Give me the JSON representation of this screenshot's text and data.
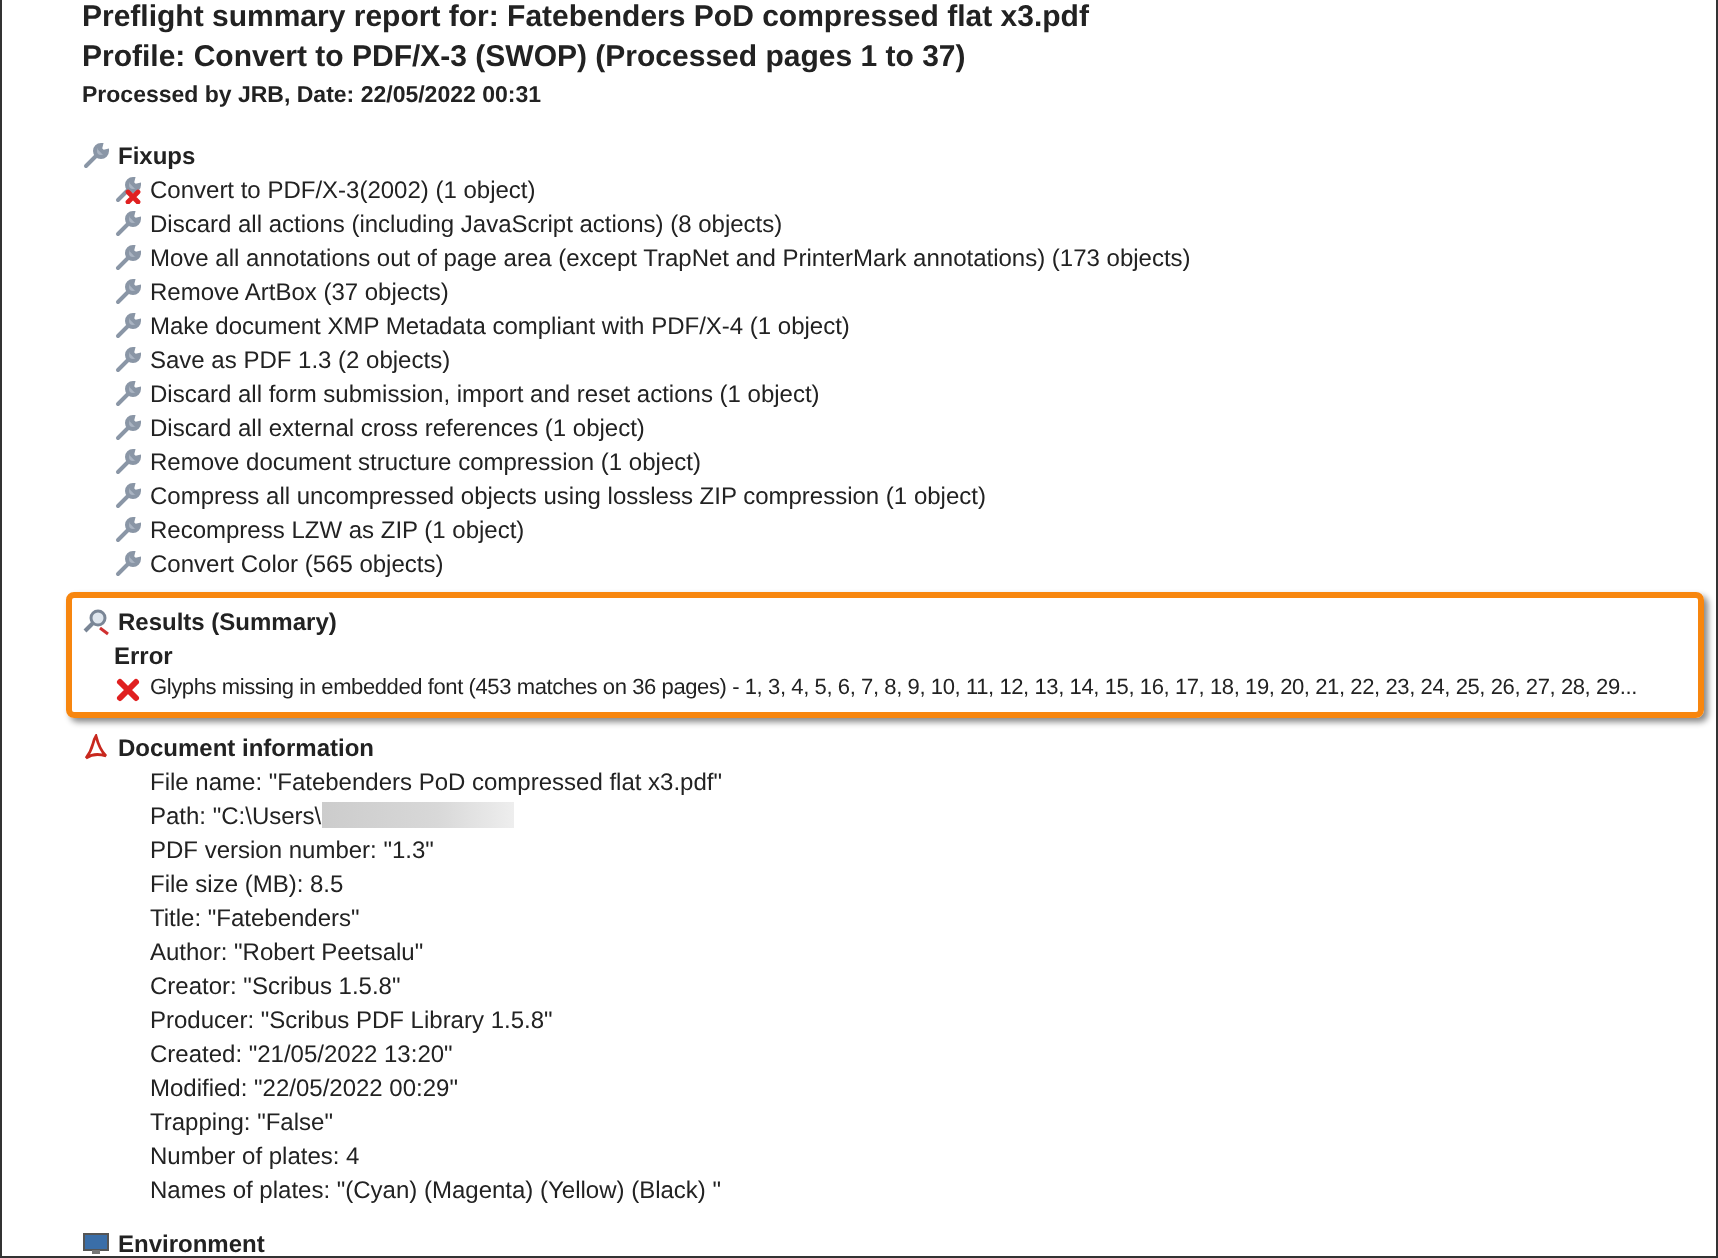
{
  "report": {
    "title": "Preflight summary report for: Fatebenders PoD compressed flat x3.pdf",
    "profile": "Profile: Convert to PDF/X-3 (SWOP) (Processed pages 1 to 37)",
    "processed_by": "Processed by JRB, Date: 22/05/2022 00:31"
  },
  "fixups": {
    "heading": "Fixups",
    "items": [
      {
        "label": "Convert to PDF/X-3(2002) (1 object)",
        "failed": true
      },
      {
        "label": "Discard all actions (including JavaScript actions) (8 objects)",
        "failed": false
      },
      {
        "label": "Move all annotations out of page area (except TrapNet and PrinterMark annotations) (173 objects)",
        "failed": false
      },
      {
        "label": "Remove ArtBox (37 objects)",
        "failed": false
      },
      {
        "label": "Make document XMP Metadata compliant with PDF/X-4 (1 object)",
        "failed": false
      },
      {
        "label": "Save as PDF 1.3 (2 objects)",
        "failed": false
      },
      {
        "label": "Discard all form submission, import and reset actions (1 object)",
        "failed": false
      },
      {
        "label": "Discard all external cross references (1 object)",
        "failed": false
      },
      {
        "label": "Remove document structure compression (1 object)",
        "failed": false
      },
      {
        "label": "Compress all uncompressed objects using lossless ZIP compression (1 object)",
        "failed": false
      },
      {
        "label": "Recompress LZW as ZIP (1 object)",
        "failed": false
      },
      {
        "label": "Convert Color (565 objects)",
        "failed": false
      }
    ]
  },
  "results": {
    "heading": "Results (Summary)",
    "highlighted": true,
    "groups": [
      {
        "severity": "Error",
        "items": [
          {
            "text": "Glyphs missing in embedded font (453 matches on 36 pages) - 1, 3, 4, 5, 6, 7, 8, 9, 10, 11, 12, 13, 14, 15, 16, 17, 18, 19, 20, 21, 22, 23, 24, 25, 26, 27, 28, 29..."
          }
        ]
      }
    ]
  },
  "document_information": {
    "heading": "Document information",
    "fields": [
      {
        "text": "File name: \"Fatebenders PoD compressed flat x3.pdf\"",
        "redacted": false
      },
      {
        "text": "Path: \"C:\\Users\\",
        "redacted": true
      },
      {
        "text": "PDF version number: \"1.3\"",
        "redacted": false
      },
      {
        "text": "File size (MB): 8.5",
        "redacted": false
      },
      {
        "text": "Title: \"Fatebenders\"",
        "redacted": false
      },
      {
        "text": "Author: \"Robert Peetsalu\"",
        "redacted": false
      },
      {
        "text": "Creator: \"Scribus 1.5.8\"",
        "redacted": false
      },
      {
        "text": "Producer: \"Scribus PDF Library 1.5.8\"",
        "redacted": false
      },
      {
        "text": "Created: \"21/05/2022 13:20\"",
        "redacted": false
      },
      {
        "text": "Modified: \"22/05/2022 00:29\"",
        "redacted": false
      },
      {
        "text": "Trapping: \"False\"",
        "redacted": false
      },
      {
        "text": "Number of plates: 4",
        "redacted": false
      },
      {
        "text": "Names of plates: \"(Cyan) (Magenta) (Yellow) (Black) \"",
        "redacted": false
      }
    ]
  },
  "environment": {
    "heading": "Environment"
  }
}
